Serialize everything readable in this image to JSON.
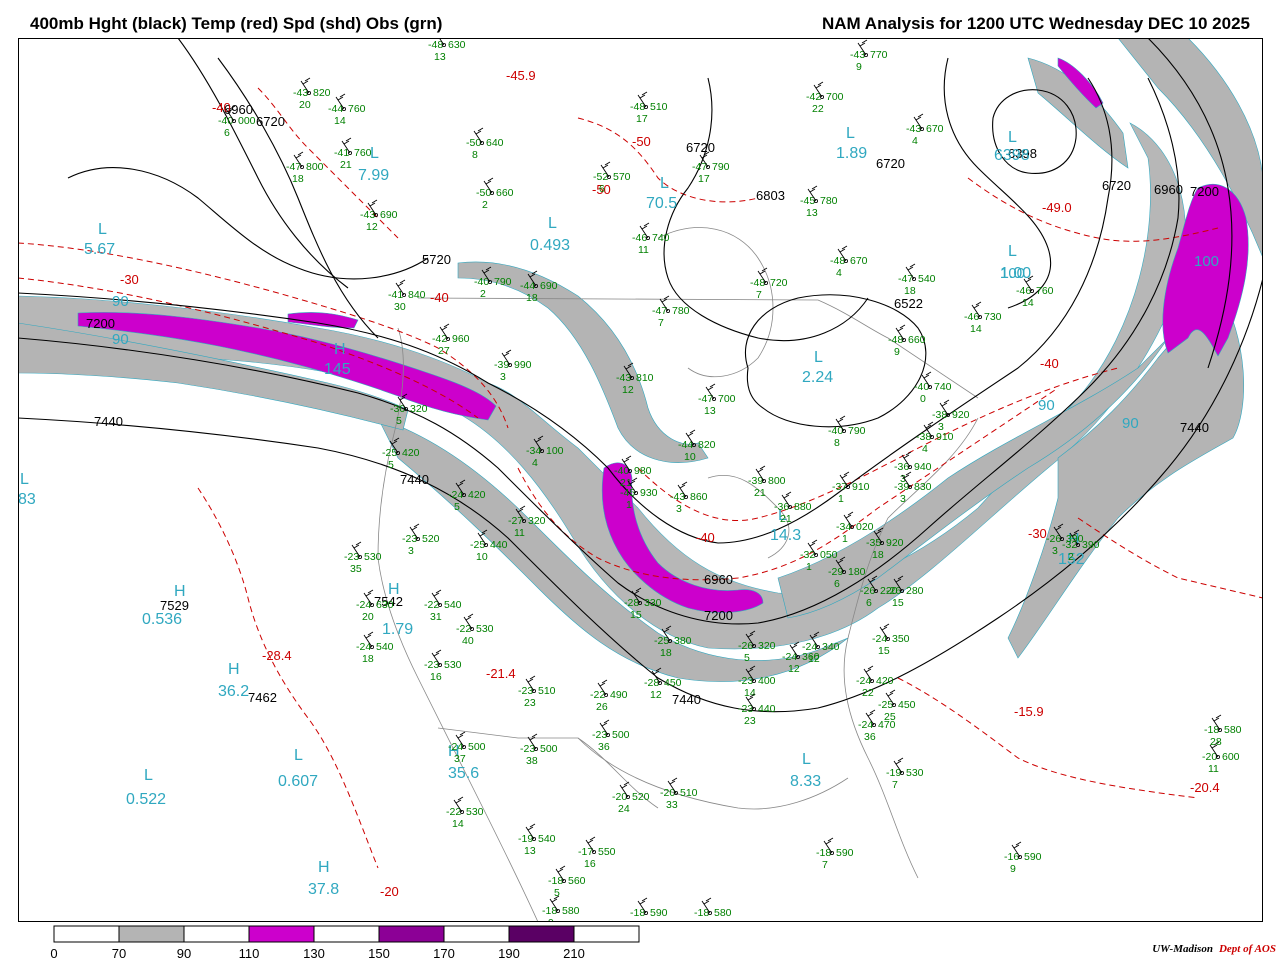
{
  "header": {
    "left_title": "400mb Hght (black) Temp (red) Spd (shd) Obs (grn)",
    "right_title": "NAM Analysis for 1200 UTC Wednesday  DEC 10 2025"
  },
  "colors": {
    "height_contours": "#000000",
    "temperature_contours": "#cc0000",
    "observations": "#008000",
    "center_labels": "#30a8c0",
    "speed_70_90": "#b4b4b4",
    "speed_110_130": "#cc00cc",
    "speed_150_170": "#8c0096",
    "speed_190_210": "#5a0064"
  },
  "colorbar": {
    "labels": [
      "0",
      "70",
      "90",
      "110",
      "130",
      "150",
      "170",
      "190",
      "210"
    ]
  },
  "credit": {
    "org": "UW-Madison",
    "dept": "Dept of AOS"
  },
  "map": {
    "height_labels": [
      "6960",
      "6720",
      "5720",
      "7200",
      "7440",
      "7440",
      "6960",
      "7200",
      "6720",
      "6803",
      "6720",
      "6398",
      "6720",
      "6960",
      "7200",
      "6522",
      "7440",
      "7529",
      "7542",
      "7462",
      "7440"
    ],
    "temp_labels": [
      "-40",
      "-30",
      "-45.9",
      "-50",
      "-50",
      "-49.0",
      "-40",
      "-40",
      "-40",
      "-30",
      "-28.4",
      "-21.4",
      "-15.9",
      "-20.4",
      "-20"
    ],
    "centers": [
      {
        "type": "L",
        "value": "5.67"
      },
      {
        "type": "L",
        "value": "7.99"
      },
      {
        "type": "L",
        "value": "0.493"
      },
      {
        "type": "L",
        "value": "70.5"
      },
      {
        "type": "L",
        "value": "1.89"
      },
      {
        "type": "L",
        "value": "6398"
      },
      {
        "type": "L",
        "value": "1.00"
      },
      {
        "type": "L",
        "value": "2.24"
      },
      {
        "type": "H",
        "value": "145"
      },
      {
        "type": "L",
        "value": "83"
      },
      {
        "type": "H",
        "value": "0.536"
      },
      {
        "type": "H",
        "value": "1.79"
      },
      {
        "type": "L",
        "value": "36.2"
      },
      {
        "type": "L",
        "value": "0.607"
      },
      {
        "type": "L",
        "value": "0.522"
      },
      {
        "type": "H",
        "value": "35.6"
      },
      {
        "type": "H",
        "value": "37.8"
      },
      {
        "type": "L",
        "value": "8.33"
      },
      {
        "type": "L",
        "value": "14.3"
      },
      {
        "type": "H",
        "value": "152"
      }
    ],
    "speed_labels": [
      "90",
      "90",
      "100",
      "90",
      "90",
      "100"
    ],
    "observations": [
      {
        "t": "-48",
        "h": "630",
        "d": "13"
      },
      {
        "t": "-43",
        "h": "820",
        "d": "20"
      },
      {
        "t": "-44",
        "h": "760",
        "d": "14"
      },
      {
        "t": "-40",
        "h": "000",
        "d": "6"
      },
      {
        "t": "-41",
        "h": "760",
        "d": "21"
      },
      {
        "t": "-47",
        "h": "800",
        "d": "18"
      },
      {
        "t": "-43",
        "h": "690",
        "d": "12"
      },
      {
        "t": "-50",
        "h": "640",
        "d": "8"
      },
      {
        "t": "-50",
        "h": "660",
        "d": "2"
      },
      {
        "t": "-52",
        "h": "570",
        "d": "6"
      },
      {
        "t": "-48",
        "h": "510",
        "d": "17"
      },
      {
        "t": "-47",
        "h": "790",
        "d": "17"
      },
      {
        "t": "-45",
        "h": "780",
        "d": "13"
      },
      {
        "t": "-43",
        "h": "770",
        "d": "9"
      },
      {
        "t": "-42",
        "h": "700",
        "d": "22"
      },
      {
        "t": "-43",
        "h": "670",
        "d": "4"
      },
      {
        "t": "-46",
        "h": "740",
        "d": "11"
      },
      {
        "t": "-48",
        "h": "670",
        "d": "4"
      },
      {
        "t": "-48",
        "h": "720",
        "d": "7"
      },
      {
        "t": "-47",
        "h": "540",
        "d": "18"
      },
      {
        "t": "-46",
        "h": "760",
        "d": "14"
      },
      {
        "t": "-46",
        "h": "730",
        "d": "14"
      },
      {
        "t": "-48",
        "h": "660",
        "d": "9"
      },
      {
        "t": "-40",
        "h": "790",
        "d": "2"
      },
      {
        "t": "-44",
        "h": "690",
        "d": "18"
      },
      {
        "t": "-47",
        "h": "780",
        "d": "7"
      },
      {
        "t": "-43",
        "h": "810",
        "d": "12"
      },
      {
        "t": "-47",
        "h": "700",
        "d": "13"
      },
      {
        "t": "-44",
        "h": "820",
        "d": "10"
      },
      {
        "t": "-41",
        "h": "840",
        "d": "30"
      },
      {
        "t": "-42",
        "h": "960",
        "d": "27"
      },
      {
        "t": "-39",
        "h": "990",
        "d": "3"
      },
      {
        "t": "-30",
        "h": "320",
        "d": "5"
      },
      {
        "t": "-25",
        "h": "420",
        "d": "5"
      },
      {
        "t": "-34",
        "h": "100",
        "d": "4"
      },
      {
        "t": "-24",
        "h": "420",
        "d": "5"
      },
      {
        "t": "-27",
        "h": "320",
        "d": "11"
      },
      {
        "t": "-23",
        "h": "520",
        "d": "3"
      },
      {
        "t": "-25",
        "h": "440",
        "d": "10"
      },
      {
        "t": "-23",
        "h": "530",
        "d": "35"
      },
      {
        "t": "-24",
        "h": "630",
        "d": "20"
      },
      {
        "t": "-22",
        "h": "540",
        "d": "31"
      },
      {
        "t": "-22",
        "h": "530",
        "d": "40"
      },
      {
        "t": "-24",
        "h": "540",
        "d": "18"
      },
      {
        "t": "-23",
        "h": "530",
        "d": "16"
      },
      {
        "t": "-23",
        "h": "510",
        "d": "23"
      },
      {
        "t": "-22",
        "h": "490",
        "d": "26"
      },
      {
        "t": "-23",
        "h": "500",
        "d": "38"
      },
      {
        "t": "-23",
        "h": "500",
        "d": "36"
      },
      {
        "t": "-24",
        "h": "500",
        "d": "37"
      },
      {
        "t": "-22",
        "h": "530",
        "d": "14"
      },
      {
        "t": "-19",
        "h": "540",
        "d": "13"
      },
      {
        "t": "-17",
        "h": "550",
        "d": "16"
      },
      {
        "t": "-18",
        "h": "560",
        "d": "5"
      },
      {
        "t": "-18",
        "h": "580",
        "d": "9"
      },
      {
        "t": "-18",
        "h": "590",
        "d": "9"
      },
      {
        "t": "-18",
        "h": "580",
        "d": "9"
      },
      {
        "t": "-20",
        "h": "520",
        "d": "24"
      },
      {
        "t": "-20",
        "h": "510",
        "d": "33"
      },
      {
        "t": "-40",
        "h": "980",
        "d": "21"
      },
      {
        "t": "-45",
        "h": "930",
        "d": "1"
      },
      {
        "t": "-43",
        "h": "860",
        "d": "3"
      },
      {
        "t": "-39",
        "h": "800",
        "d": "21"
      },
      {
        "t": "-36",
        "h": "880",
        "d": "21"
      },
      {
        "t": "-37",
        "h": "910",
        "d": "1"
      },
      {
        "t": "-34",
        "h": "020",
        "d": "1"
      },
      {
        "t": "-32",
        "h": "050",
        "d": "1"
      },
      {
        "t": "-35",
        "h": "920",
        "d": "18"
      },
      {
        "t": "-28",
        "h": "330",
        "d": "15"
      },
      {
        "t": "-25",
        "h": "380",
        "d": "18"
      },
      {
        "t": "-28",
        "h": "450",
        "d": "12"
      },
      {
        "t": "-23",
        "h": "400",
        "d": "14"
      },
      {
        "t": "-23",
        "h": "440",
        "d": "23"
      },
      {
        "t": "-24",
        "h": "420",
        "d": "22"
      },
      {
        "t": "-25",
        "h": "450",
        "d": "25"
      },
      {
        "t": "-26",
        "h": "320",
        "d": "5"
      },
      {
        "t": "-24",
        "h": "360",
        "d": "12"
      },
      {
        "t": "-24",
        "h": "340",
        "d": "12"
      },
      {
        "t": "-24",
        "h": "350",
        "d": "15"
      },
      {
        "t": "-29",
        "h": "180",
        "d": "6"
      },
      {
        "t": "-26",
        "h": "220",
        "d": "6"
      },
      {
        "t": "-26",
        "h": "280",
        "d": "15"
      },
      {
        "t": "-24",
        "h": "470",
        "d": "36"
      },
      {
        "t": "-19",
        "h": "530",
        "d": "7"
      },
      {
        "t": "-18",
        "h": "590",
        "d": "7"
      },
      {
        "t": "-16",
        "h": "590",
        "d": "9"
      },
      {
        "t": "-20",
        "h": "600",
        "d": "11"
      },
      {
        "t": "-18",
        "h": "580",
        "d": "28"
      },
      {
        "t": "-40",
        "h": "790",
        "d": "8"
      },
      {
        "t": "-38",
        "h": "910",
        "d": "4"
      },
      {
        "t": "-36",
        "h": "940",
        "d": "3"
      },
      {
        "t": "-40",
        "h": "740",
        "d": "0"
      },
      {
        "t": "-38",
        "h": "920",
        "d": "3"
      },
      {
        "t": "-39",
        "h": "830",
        "d": "3"
      },
      {
        "t": "-32",
        "h": "390",
        "d": "2"
      },
      {
        "t": "-26",
        "h": "390",
        "d": "3"
      }
    ]
  }
}
